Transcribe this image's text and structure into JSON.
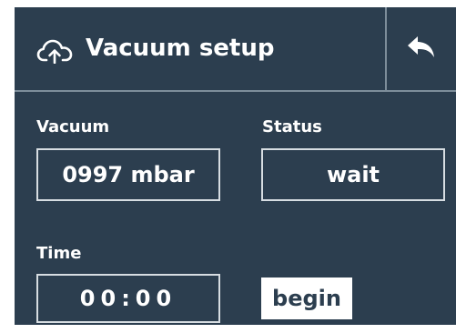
{
  "header": {
    "title": "Vacuum setup",
    "title_icon": "cloud-upload-icon",
    "back_icon": "reply-arrow-icon"
  },
  "fields": {
    "vacuum": {
      "label": "Vacuum",
      "value": "0997 mbar"
    },
    "status": {
      "label": "Status",
      "value": "wait"
    },
    "time": {
      "label": "Time",
      "value": "00:00"
    }
  },
  "actions": {
    "begin_label": "begin"
  },
  "colors": {
    "background": "#2c3e4f",
    "text": "#ffffff",
    "border": "#d7dde2",
    "divider": "#7d8d9a",
    "page": "#ffffff"
  }
}
